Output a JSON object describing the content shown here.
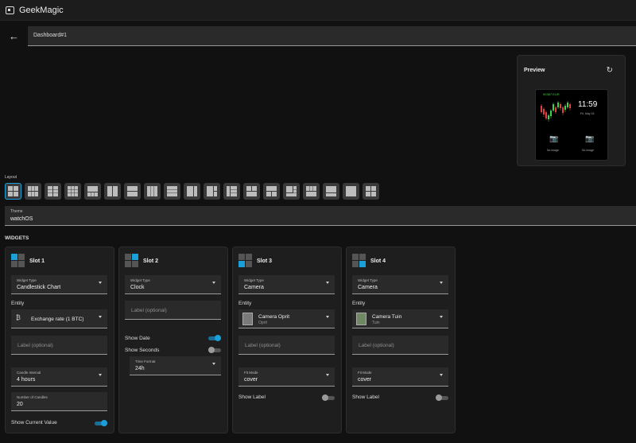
{
  "app": {
    "title": "GeekMagic",
    "icon": "monitor-icon"
  },
  "dashboard": {
    "name": "Dashboard#1"
  },
  "preview": {
    "title": "Preview",
    "device": {
      "price": "90387 EUR",
      "time": "11:59",
      "date": "Fri, May 15",
      "no_image_left": "No image",
      "no_image_right": "No image"
    }
  },
  "layout": {
    "label": "Layout",
    "options_count": 19,
    "selected_index": 0
  },
  "theme": {
    "label": "Theme",
    "value": "watchOS"
  },
  "widgets": {
    "title": "WIDGETS",
    "slots": [
      {
        "title": "Slot 1",
        "widget_type_label": "Widget Type",
        "widget_type": "Candlestick Chart",
        "entity_label": "Entity",
        "entity_name": "Exchange rate (1 BTC)",
        "entity_icon": "bitcoin-icon",
        "label_placeholder": "Label (optional)",
        "candle_interval_label": "Candle Interval",
        "candle_interval": "4 hours",
        "num_candles_label": "Number of Candles",
        "num_candles": "20",
        "show_current_value_label": "Show Current Value",
        "show_current_value": true
      },
      {
        "title": "Slot 2",
        "widget_type_label": "Widget Type",
        "widget_type": "Clock",
        "label_placeholder": "Label (optional)",
        "show_date_label": "Show Date",
        "show_date": true,
        "show_seconds_label": "Show Seconds",
        "show_seconds": false,
        "time_format_label": "Time Format",
        "time_format": "24h"
      },
      {
        "title": "Slot 3",
        "widget_type_label": "Widget Type",
        "widget_type": "Camera",
        "entity_label": "Entity",
        "entity_name": "Camera Oprit",
        "entity_sub": "Oprit",
        "label_placeholder": "Label (optional)",
        "fit_mode_label": "Fit Mode",
        "fit_mode": "cover",
        "show_label_label": "Show Label",
        "show_label": false
      },
      {
        "title": "Slot 4",
        "widget_type_label": "Widget Type",
        "widget_type": "Camera",
        "entity_label": "Entity",
        "entity_name": "Camera Tuin",
        "entity_sub": "Tuin",
        "label_placeholder": "Label (optional)",
        "fit_mode_label": "Fit Mode",
        "fit_mode": "cover",
        "show_label_label": "Show Label",
        "show_label": false
      }
    ]
  },
  "colors": {
    "accent": "#1a9fd8",
    "background": "#111111",
    "card": "#1e1e1e",
    "field": "#2a2a2a"
  }
}
